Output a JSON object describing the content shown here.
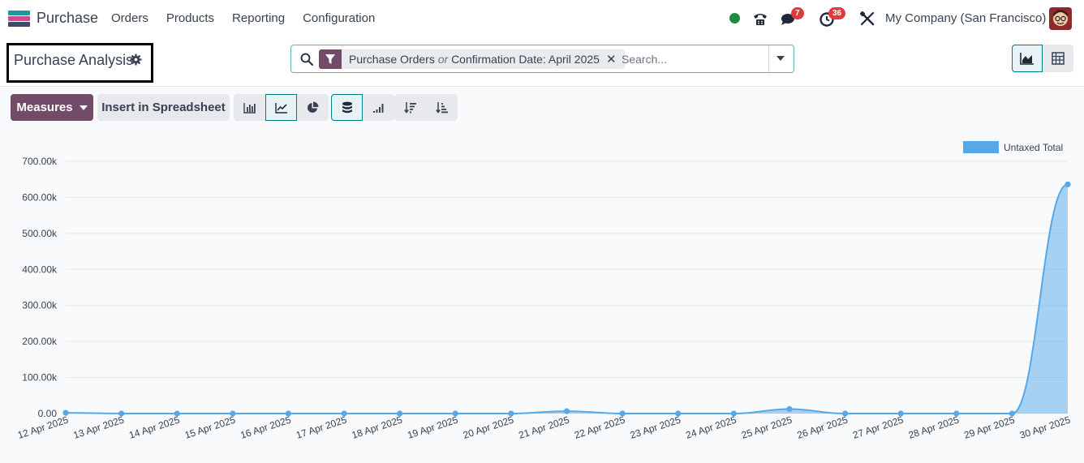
{
  "app": {
    "name": "Purchase",
    "icon_colors": [
      "#1b9b9b",
      "#d14b8a",
      "#3b4b63"
    ]
  },
  "menu": [
    "Orders",
    "Products",
    "Reporting",
    "Configuration"
  ],
  "systray": {
    "chat_count": "7",
    "activity_count": "36",
    "company": "My Company (San Francisco)",
    "status_color": "#1e8e3e"
  },
  "control": {
    "title": "Purchase Analysis",
    "facet_text_a": "Purchase Orders",
    "facet_or": "or",
    "facet_text_b": "Confirmation Date: April 2025",
    "search_placeholder": "Search...",
    "remove_symbol": "✕"
  },
  "toolbar": {
    "measures_label": "Measures",
    "spreadsheet_label": "Insert in Spreadsheet"
  },
  "colors": {
    "brand": "#714b67",
    "accent": "#017e84",
    "series": "#55a8ea"
  },
  "chart_data": {
    "type": "area",
    "x": [
      "12 Apr 2025",
      "13 Apr 2025",
      "14 Apr 2025",
      "15 Apr 2025",
      "16 Apr 2025",
      "17 Apr 2025",
      "18 Apr 2025",
      "19 Apr 2025",
      "20 Apr 2025",
      "21 Apr 2025",
      "22 Apr 2025",
      "23 Apr 2025",
      "24 Apr 2025",
      "25 Apr 2025",
      "26 Apr 2025",
      "27 Apr 2025",
      "28 Apr 2025",
      "29 Apr 2025",
      "30 Apr 2025"
    ],
    "series": [
      {
        "name": "Untaxed Total",
        "values": [
          2000,
          0,
          0,
          0,
          0,
          0,
          0,
          0,
          0,
          6500,
          0,
          0,
          0,
          12500,
          0,
          0,
          0,
          0,
          636000
        ]
      }
    ],
    "yticks": [
      "0.00",
      "100.00k",
      "200.00k",
      "300.00k",
      "400.00k",
      "500.00k",
      "600.00k",
      "700.00k"
    ],
    "ylim": [
      0,
      700000
    ],
    "grid": true,
    "legend": "top-right"
  }
}
